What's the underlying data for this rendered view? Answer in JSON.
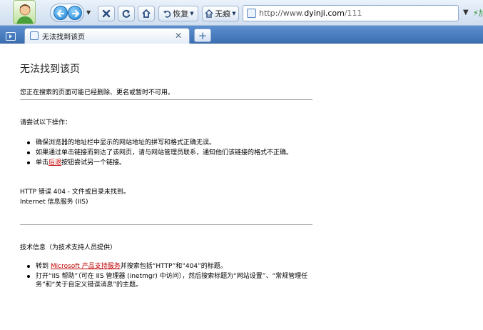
{
  "toolbar": {
    "restore_label": "恢复",
    "notrace_label": "无痕",
    "address": {
      "prefix": "http://www.",
      "host": "dyinji.com",
      "path": "/111"
    },
    "accelerate_label": "加速"
  },
  "tab": {
    "title": "无法找到该页"
  },
  "page": {
    "heading": "无法找到该页",
    "subtitle": "您正在搜索的页面可能已经删除、更名或暂时不可用。",
    "try_heading": "请尝试以下操作：",
    "try_items": {
      "item1": "确保浏览器的地址栏中显示的网站地址的拼写和格式正确无误。",
      "item2": "如果通过单击链接而到达了该网页，请与网站管理员联系，通知他们该链接的格式不正确。",
      "item3_before": "单击",
      "item3_link": "后退",
      "item3_after": "按钮尝试另一个链接。"
    },
    "error_line1": "HTTP 错误 404 - 文件或目录未找到。",
    "error_line2": "Internet 信息服务 (IIS)",
    "tech_heading": "技术信息（为技术支持人员提供）",
    "tech_items": {
      "item1_before": "转到 ",
      "item1_link": "Microsoft 产品支持服务",
      "item1_after": "并搜索包括“HTTP”和“404”的标题。",
      "item2": "打开“IIS 帮助”（可在 IIS 管理器 (inetmgr) 中访问），然后搜索标题为“网站设置”、“常规管理任务”和“关于自定义错误消息”的主题。"
    }
  }
}
